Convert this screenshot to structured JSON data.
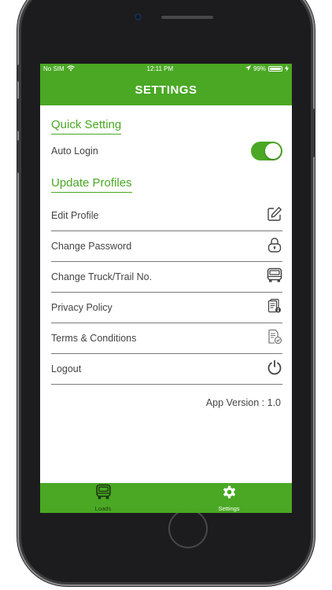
{
  "status_bar": {
    "carrier": "No SIM",
    "time": "12:11 PM",
    "battery": "99%",
    "battery_level": 0.99
  },
  "header": {
    "title": "SETTINGS"
  },
  "quick_setting": {
    "heading": "Quick Setting",
    "auto_login": {
      "label": "Auto Login",
      "enabled": true
    }
  },
  "update_profiles": {
    "heading": "Update Profiles",
    "items": [
      {
        "label": "Edit Profile",
        "icon": "edit-icon"
      },
      {
        "label": "Change Password",
        "icon": "lock-icon"
      },
      {
        "label": "Change Truck/Trail No.",
        "icon": "truck-icon"
      },
      {
        "label": "Privacy Policy",
        "icon": "document-icon"
      },
      {
        "label": "Terms & Conditions",
        "icon": "checked-document-icon"
      },
      {
        "label": "Logout",
        "icon": "power-icon"
      }
    ]
  },
  "app_version": "App Version : 1.0",
  "tab_bar": {
    "tabs": [
      {
        "label": "Loads",
        "icon": "truck-icon",
        "active": false
      },
      {
        "label": "Settings",
        "icon": "gear-icon",
        "active": true
      }
    ]
  },
  "colors": {
    "accent": "#4aa824",
    "text": "#444444",
    "divider": "#7a7a7a"
  }
}
